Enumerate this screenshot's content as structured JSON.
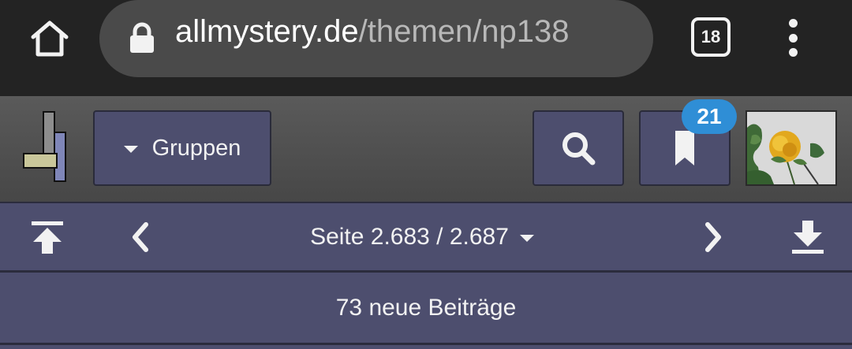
{
  "browser": {
    "url_host": "allmystery.de",
    "url_path": "/themen/np138",
    "tab_count": "18",
    "icons": [
      "home-icon",
      "lock-icon",
      "tabs-icon",
      "more-vert-icon"
    ]
  },
  "header": {
    "groups_label": "Gruppen",
    "bookmark_badge": "21",
    "icons": [
      "site-logo",
      "search-icon",
      "bookmark-icon",
      "avatar-image"
    ]
  },
  "pagination": {
    "page_label": "Seite 2.683 / 2.687",
    "icons": [
      "jump-top-icon",
      "chevron-left-icon",
      "chevron-right-icon",
      "jump-bottom-icon"
    ]
  },
  "new_posts_label": "73 neue Beiträge",
  "colors": {
    "chrome_bg": "#232323",
    "url_pill": "#4a4a4a",
    "header_bg": "#505050",
    "button_bg": "#4d4e6e",
    "badge": "#2f8ed6"
  }
}
